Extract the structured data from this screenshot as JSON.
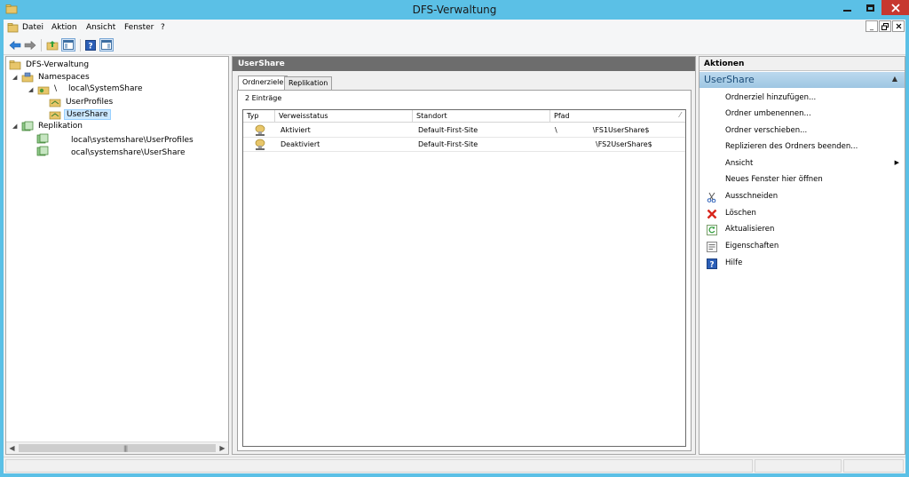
{
  "window": {
    "title": "DFS-Verwaltung"
  },
  "menu": {
    "items": [
      "Datei",
      "Aktion",
      "Ansicht",
      "Fenster",
      "?"
    ]
  },
  "tree": {
    "root": "DFS-Verwaltung",
    "namespaces": "Namespaces",
    "namespace_path": "local\\SystemShare",
    "userprofiles": "UserProfiles",
    "usershare": "UserShare",
    "replication": "Replikation",
    "repl_group_1": "local\\systemshare\\UserProfiles",
    "repl_group_2": "ocal\\systemshare\\UserShare"
  },
  "center": {
    "header": "UserShare",
    "tabs": [
      "Ordnerziele",
      "Replikation"
    ],
    "entries_count": "2 Einträge",
    "columns": [
      "Typ",
      "Verweisstatus",
      "Standort",
      "Pfad"
    ],
    "rows": [
      {
        "status": "Aktiviert",
        "site": "Default-First-Site",
        "path_prefix": "\\",
        "path_suffix": "\\FS1UserShare$"
      },
      {
        "status": "Deaktiviert",
        "site": "Default-First-Site",
        "path_prefix": "",
        "path_suffix": "\\FS2UserShare$"
      }
    ]
  },
  "actions": {
    "header": "Aktionen",
    "section": "UserShare",
    "items": [
      "Ordnerziel hinzufügen...",
      "Ordner umbenennen...",
      "Ordner verschieben...",
      "Replizieren des Ordners beenden...",
      "Ansicht",
      "Neues Fenster hier öffnen",
      "Ausschneiden",
      "Löschen",
      "Aktualisieren",
      "Eigenschaften",
      "Hilfe"
    ]
  },
  "colors": {
    "title_bar": "#5bc0e6",
    "close_button": "#c7382f",
    "center_header": "#6d6d6d",
    "actions_section": "#9ec6e2",
    "selection": "#cce8ff"
  }
}
